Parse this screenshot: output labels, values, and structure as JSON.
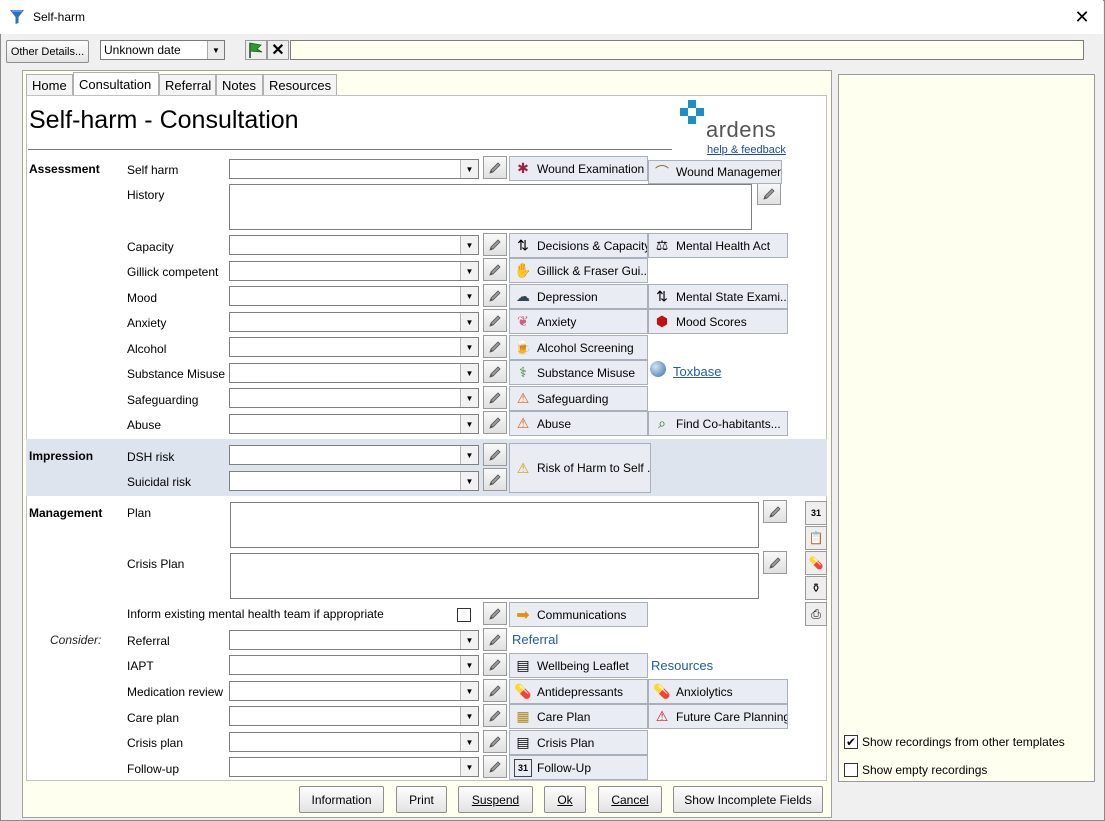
{
  "window": {
    "title": "Self-harm",
    "close_glyph": "✕"
  },
  "toolbar": {
    "other_details_label": "Other Details...",
    "date_value": "Unknown date",
    "notes_value": ""
  },
  "tabs": [
    {
      "label": "Home"
    },
    {
      "label": "Consultation"
    },
    {
      "label": "Referral"
    },
    {
      "label": "Notes"
    },
    {
      "label": "Resources"
    }
  ],
  "page": {
    "title": "Self-harm - Consultation",
    "logo_text": "ardens",
    "help_link": "help & feedback"
  },
  "sections": {
    "assessment": "Assessment",
    "impression": "Impression",
    "management": "Management",
    "consider": "Consider:"
  },
  "fields": {
    "self_harm": "Self harm",
    "history": "History",
    "capacity": "Capacity",
    "gillick": "Gillick competent",
    "mood": "Mood",
    "anxiety": "Anxiety",
    "alcohol": "Alcohol",
    "substance": "Substance Misuse",
    "safeguarding": "Safeguarding",
    "abuse": "Abuse",
    "dsh_risk": "DSH risk",
    "suicidal_risk": "Suicidal risk",
    "plan": "Plan",
    "crisis_plan_memo": "Crisis Plan",
    "inform_team": "Inform existing mental health team if appropriate",
    "referral": "Referral",
    "iapt": "IAPT",
    "medication_review": "Medication review",
    "care_plan": "Care plan",
    "crisis_plan": "Crisis plan",
    "follow_up": "Follow-up"
  },
  "buttons": {
    "wound_examination": "Wound Examination",
    "wound_management": "Wound Management",
    "decisions_capacity": "Decisions & Capacity",
    "mental_health_act": "Mental Health Act",
    "gillick_fraser": "Gillick & Fraser Gui...",
    "depression": "Depression",
    "mental_state": "Mental State Exami...",
    "anxiety": "Anxiety",
    "mood_scores": "Mood Scores",
    "alcohol_screening": "Alcohol Screening",
    "substance_misuse": "Substance Misuse",
    "toxbase": "Toxbase",
    "safeguarding": "Safeguarding",
    "abuse": "Abuse",
    "find_cohabitants": "Find Co-habitants...",
    "risk_of_harm": "Risk of Harm to Self ...",
    "communications": "Communications",
    "referral_link": "Referral",
    "wellbeing_leaflet": "Wellbeing Leaflet",
    "resources_link": "Resources",
    "antidepressants": "Antidepressants",
    "anxiolytics": "Anxiolytics",
    "care_plan": "Care Plan",
    "future_care_planning": "Future Care Planning",
    "crisis_plan": "Crisis Plan",
    "follow_up": "Follow-Up"
  },
  "right_panel": {
    "show_other_templates": "Show recordings from other templates",
    "show_other_templates_checked": true,
    "show_empty": "Show empty recordings",
    "show_empty_checked": false
  },
  "footer": {
    "information": "Information",
    "print": "Print",
    "suspend": "Suspend",
    "ok": "Ok",
    "cancel": "Cancel",
    "show_incomplete": "Show Incomplete Fields"
  },
  "icons": {
    "app": "filter-funnel-icon",
    "flag": "green-flag-icon",
    "clear": "x-icon",
    "pencil": "pencil-icon",
    "calendar_day": "31"
  }
}
